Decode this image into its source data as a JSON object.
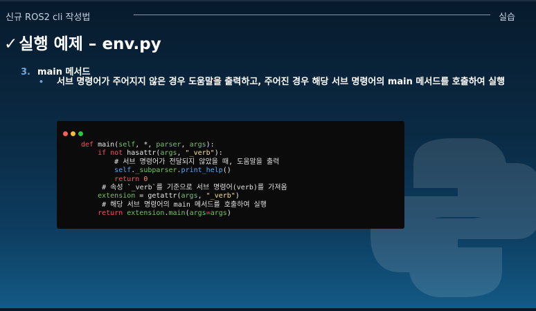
{
  "header": {
    "left": "신규 ROS2 cli 작성법",
    "right": "실습"
  },
  "title": {
    "check": "✓",
    "text": "실행 예제 – env.py"
  },
  "section": {
    "number": "3.",
    "title": "main 메서드"
  },
  "bullet": {
    "marker": "•",
    "text": "서브 명령어가 주어지지 않은 경우 도움말을 출력하고, 주어진 경우 해당 서브 명령어의 main 메서드를 호출하여 실행"
  },
  "code": {
    "l1": {
      "a": "def",
      "b": " main(",
      "c": "self",
      "d": ", *, ",
      "e": "parser",
      "f": ", ",
      "g": "args",
      "h": "):"
    },
    "l2": {
      "a": "    ",
      "b": "if not",
      "c": " hasattr(",
      "d": "args",
      "e": ", ",
      "f": "\"_verb\"",
      "g": "):"
    },
    "l3": "        # 서브 명령어가 전달되지 않았을 때, 도움말을 출력",
    "l4": {
      "a": "        ",
      "b": "self",
      "c": ".",
      "d": "_subparser",
      "e": ".",
      "f": "print_help",
      "g": "()"
    },
    "l5": {
      "a": "        ",
      "b": "return",
      "c": " ",
      "d": "0"
    },
    "l6": "     # 속성 `_verb`를 기준으로 서브 명령어(verb)를 가져옴",
    "l7": {
      "a": "    ",
      "b": "extension",
      "c": " = getattr(",
      "d": "args",
      "e": ", ",
      "f": "\"_verb\"",
      "g": ")"
    },
    "l8": "     # 해당 서브 명령어의 main 메서드를 호출하여 실행",
    "l9": {
      "a": "    ",
      "b": "return",
      "c": " ",
      "d": "extension",
      "e": ".",
      "f": "main",
      "g": "(",
      "h": "args",
      "i": "=",
      "j": "args",
      "k": ")"
    }
  },
  "colors": {
    "dot_red": "#ff5f57",
    "dot_yellow": "#febc2e",
    "dot_green": "#28c840"
  }
}
